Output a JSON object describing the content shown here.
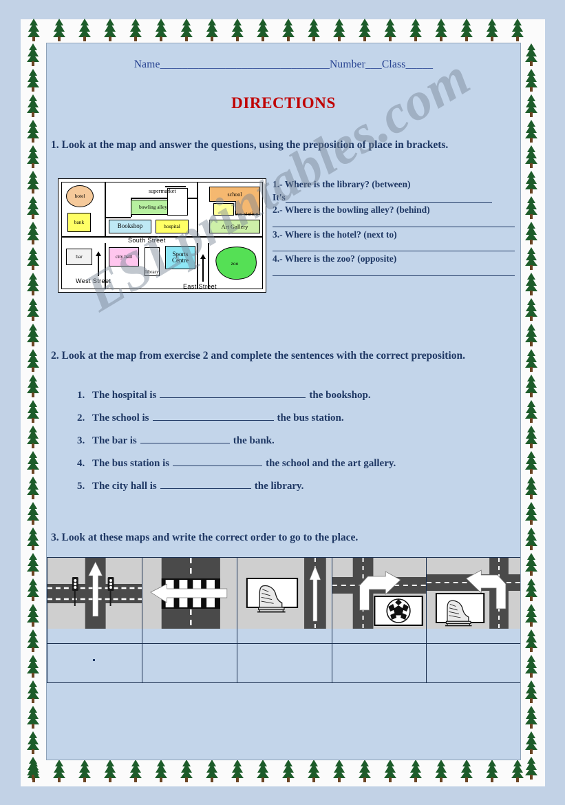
{
  "header": {
    "name_label": "Name",
    "name_blank": "_______________________________",
    "number_label": "Number",
    "number_blank": "___",
    "class_label": "Class",
    "class_blank": "_____",
    "title": "DIRECTIONS"
  },
  "watermark": "ESLprintables.com",
  "colors": {
    "page_bg": "#c2d2e6",
    "sheet_bg": "#c3d5ea",
    "title_red": "#c00000",
    "text_blue": "#1f3864",
    "name_blue": "#24408f",
    "tree_green": "#1d5c2a",
    "tree_trunk": "#6b4423"
  },
  "exercise1": {
    "instruction": "1. Look at the map and answer the questions, using the preposition of place in brackets.",
    "questions": [
      {
        "number": "1.-",
        "text": "Where is the library? (between)",
        "answer_prefix": "It's"
      },
      {
        "number": "2.-",
        "text": "Where is the bowling alley? (behind)",
        "answer_prefix": ""
      },
      {
        "number": "3.-",
        "text": "Where is the hotel? (next to)",
        "answer_prefix": ""
      },
      {
        "number": "4.-",
        "text": "Where is the zoo? (opposite)",
        "answer_prefix": ""
      }
    ]
  },
  "map": {
    "places": [
      {
        "name": "hotel",
        "color": "#f5c99a",
        "shape": "circle"
      },
      {
        "name": "bank",
        "color": "#ffff66",
        "shape": "rect"
      },
      {
        "name": "bowling alley",
        "color": "#b7f0a0",
        "shape": "rect"
      },
      {
        "name": "supermarket",
        "color": "#ffffff",
        "shape": "rect"
      },
      {
        "name": "Bookshop",
        "color": "#bfe9f5",
        "shape": "rect"
      },
      {
        "name": "hospital",
        "color": "#ffff66",
        "shape": "rect"
      },
      {
        "name": "school",
        "color": "#f5b870",
        "shape": "lshape"
      },
      {
        "name": "bus station",
        "color": "#ffff99",
        "shape": "rect"
      },
      {
        "name": "Art Gallery",
        "color": "#cdf0a8",
        "shape": "rect"
      },
      {
        "name": "bar",
        "color": "#f2f2f2",
        "shape": "rect"
      },
      {
        "name": "city hall",
        "color": "#ffc6ee",
        "shape": "rect"
      },
      {
        "name": "library",
        "color": "#ffffff",
        "shape": "rect"
      },
      {
        "name": "Sports Centre",
        "color": "#8ee6f5",
        "shape": "rect"
      },
      {
        "name": "zoo",
        "color": "#55e055",
        "shape": "blob"
      }
    ],
    "streets": [
      "South Street",
      "West Street",
      "East Street"
    ]
  },
  "exercise2": {
    "instruction": "2. Look at the map from exercise 2 and complete the sentences with the correct preposition.",
    "sentences": [
      {
        "number": "1.",
        "before": "The hospital is",
        "after": "the bookshop.",
        "blank_width": 212
      },
      {
        "number": "2.",
        "before": "The school is",
        "after": "the bus station.",
        "blank_width": 176
      },
      {
        "number": "3.",
        "before": "The bar is",
        "after": "the bank.",
        "blank_width": 130
      },
      {
        "number": "4.",
        "before": "The bus station is",
        "after": "the school and the art gallery.",
        "blank_width": 130
      },
      {
        "number": "5.",
        "before": "The city hall is",
        "after": "the library.",
        "blank_width": 132
      }
    ]
  },
  "exercise3": {
    "instruction": "3. Look at these maps and write the correct order to go to the place.",
    "cells": [
      {
        "id": "cell-1",
        "scene": "crossroads-traffic-lights-straight-arrow",
        "answer": "."
      },
      {
        "id": "cell-2",
        "scene": "zebra-crossing-left-arrow",
        "answer": ""
      },
      {
        "id": "cell-3",
        "scene": "ice-skate-sign-straight-arrow",
        "answer": ""
      },
      {
        "id": "cell-4",
        "scene": "crossroads-right-arrow-football-sign",
        "answer": ""
      },
      {
        "id": "cell-5",
        "scene": "crossroads-left-arrow-ice-skate-sign",
        "answer": ""
      }
    ]
  }
}
